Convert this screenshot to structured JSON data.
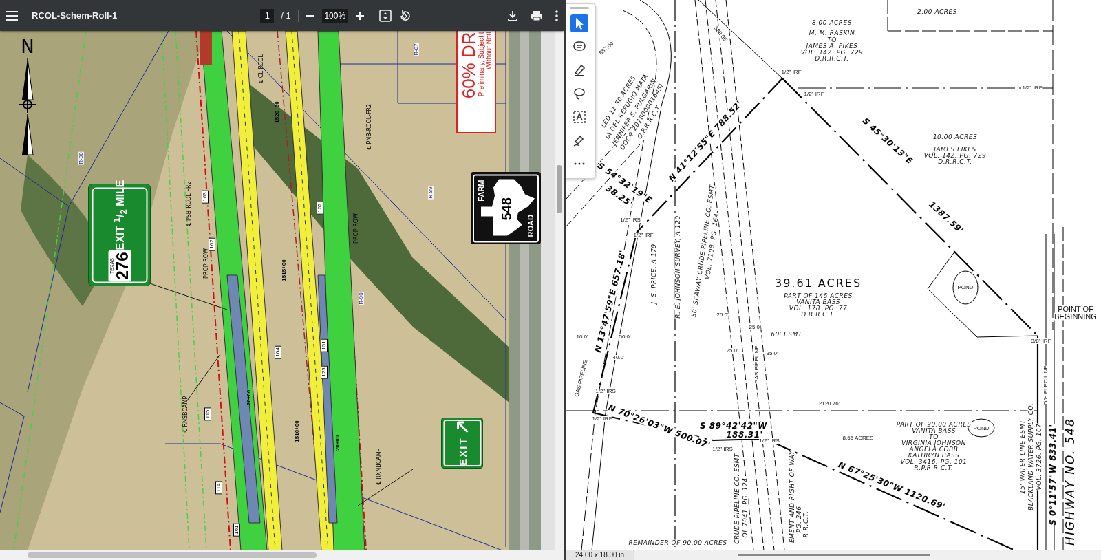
{
  "left_viewer": {
    "title": "RCOL-Schem-Roll-1",
    "page": "1",
    "page_total": "/ 1",
    "zoom": "100%",
    "map_labels": [
      {
        "text": "N",
        "kind": "north"
      },
      {
        "text": "R-88",
        "kind": "grid"
      },
      {
        "text": "R-87",
        "kind": "grid"
      },
      {
        "text": "R-89",
        "kind": "grid"
      },
      {
        "text": "R-90",
        "kind": "grid"
      },
      {
        "text": "1520+00",
        "kind": "station"
      },
      {
        "text": "1515+00",
        "kind": "station"
      },
      {
        "text": "1510+00",
        "kind": "station"
      },
      {
        "text": "163",
        "kind": "callout"
      },
      {
        "text": "162",
        "kind": "callout"
      },
      {
        "text": "152",
        "kind": "callout"
      },
      {
        "text": "151",
        "kind": "callout"
      },
      {
        "text": "123",
        "kind": "callout"
      },
      {
        "text": "104",
        "kind": "callout"
      },
      {
        "text": "115",
        "kind": "callout"
      },
      {
        "text": "114",
        "kind": "callout"
      },
      {
        "text": "161",
        "kind": "callout"
      },
      {
        "text": "℄ PSB-RCOL-FR2",
        "kind": "note"
      },
      {
        "text": "℄ PNB-RCOL-FR2",
        "kind": "note"
      },
      {
        "text": "℄ CL RCOL",
        "kind": "note"
      },
      {
        "text": "PROP ROW",
        "kind": "note"
      },
      {
        "text": "PROP ROW",
        "kind": "note"
      },
      {
        "text": "℄ RNSBCAMP",
        "kind": "note"
      },
      {
        "text": "℄ RXNBCAMP",
        "kind": "note"
      },
      {
        "text": "20+00",
        "kind": "station"
      },
      {
        "text": "20+00",
        "kind": "station"
      }
    ],
    "stamp": {
      "lines": [
        "60% DR",
        "Preliminary, Subject t",
        "Without Noti"
      ]
    },
    "signs": [
      {
        "kind": "guide",
        "shield_top": "TEXAS",
        "shield_number": "276",
        "legend": "EXIT $^{1}$/$_{2}$ MILE"
      },
      {
        "kind": "farm_road",
        "top": "FARM",
        "number": "548",
        "bottom": "ROAD"
      },
      {
        "kind": "exit",
        "legend": "EXIT"
      }
    ]
  },
  "right_viewer": {
    "tools": [
      {
        "kind": "select",
        "selected": true
      },
      {
        "kind": "comment",
        "selected": false
      },
      {
        "kind": "highlight",
        "selected": false
      },
      {
        "kind": "lasso",
        "selected": false
      },
      {
        "kind": "text",
        "selected": false
      },
      {
        "kind": "sign",
        "selected": false
      },
      {
        "kind": "more",
        "selected": false
      }
    ],
    "plat_labels": [
      {
        "text": "2.00 ACRES",
        "kind": "note"
      },
      {
        "text": "8.00 ACRES",
        "kind": "note"
      },
      {
        "text": "M. M. RASKIN",
        "kind": "note"
      },
      {
        "text": "TO",
        "kind": "note"
      },
      {
        "text": "JAMES A. FIKES",
        "kind": "note"
      },
      {
        "text": "VOL. 142. PG. 729",
        "kind": "note"
      },
      {
        "text": "D.R.R.C.T.",
        "kind": "note"
      },
      {
        "text": "1/2\" IRF",
        "kind": "marker"
      },
      {
        "text": "1/2\" IRF",
        "kind": "marker"
      },
      {
        "text": "1/2\" IRF",
        "kind": "marker"
      },
      {
        "text": "10.00 ACRES",
        "kind": "note"
      },
      {
        "text": "JAMES FIKES",
        "kind": "note"
      },
      {
        "text": "VOL. 142. PG. 729",
        "kind": "note"
      },
      {
        "text": "D.R.R.C.T.",
        "kind": "note"
      },
      {
        "text": "S 45°30'13\"E",
        "kind": "bearing"
      },
      {
        "text": "1387.59'",
        "kind": "bearing"
      },
      {
        "text": "N 41°12'55\"E 788.52'",
        "kind": "bearing"
      },
      {
        "text": "S 54°32'19\"E",
        "kind": "bearing"
      },
      {
        "text": "38.25'",
        "kind": "bearing"
      },
      {
        "text": "1/2\" IRS",
        "kind": "marker"
      },
      {
        "text": "1/2\" IRF",
        "kind": "marker"
      },
      {
        "text": "J. S. PRICE, A-179",
        "kind": "note"
      },
      {
        "text": "R. E. JOHNSON SURVEY, A-120",
        "kind": "note"
      },
      {
        "text": "50' SEAWAY CRUDE PIPELINE CO. ESMT",
        "kind": "note"
      },
      {
        "text": "VOL. 7108. PG. 164",
        "kind": "note"
      },
      {
        "text": "39.61 ACRES",
        "kind": "title"
      },
      {
        "text": "PART OF 146 ACRES",
        "kind": "note"
      },
      {
        "text": "VANITA BASS",
        "kind": "note"
      },
      {
        "text": "VOL. 178. PG. 77",
        "kind": "note"
      },
      {
        "text": "D.R.R.C.T.",
        "kind": "note"
      },
      {
        "text": "POND",
        "kind": "marker"
      },
      {
        "text": "POINT OF",
        "kind": "plain"
      },
      {
        "text": "BEGINNING",
        "kind": "plain"
      },
      {
        "text": "3/8\" IRF",
        "kind": "marker"
      },
      {
        "text": "N 13°47'59\"E 657.18'",
        "kind": "bearing"
      },
      {
        "text": "60' ESMT",
        "kind": "note"
      },
      {
        "text": "25.0'",
        "kind": "marker"
      },
      {
        "text": "25.0'",
        "kind": "marker"
      },
      {
        "text": "25.0'",
        "kind": "marker"
      },
      {
        "text": "35.0'",
        "kind": "marker"
      },
      {
        "text": "10.0'",
        "kind": "marker"
      },
      {
        "text": "50.0'",
        "kind": "marker"
      },
      {
        "text": "40.0'",
        "kind": "marker"
      },
      {
        "text": "GAS PIPELINE",
        "kind": "marker"
      },
      {
        "text": "GAS PIPELINE",
        "kind": "marker"
      },
      {
        "text": "O/H ELEC LINE",
        "kind": "marker"
      },
      {
        "text": "2120.76'",
        "kind": "marker"
      },
      {
        "text": "1/2\" IRS",
        "kind": "marker"
      },
      {
        "text": "1/2\" IRF",
        "kind": "marker"
      },
      {
        "text": "N 70°26'03\"W 500.07'",
        "kind": "bearing"
      },
      {
        "text": "S 89°42'42\"W",
        "kind": "bearing"
      },
      {
        "text": "188.31'",
        "kind": "bearing"
      },
      {
        "text": "1/2\" IRS",
        "kind": "marker"
      },
      {
        "text": "1/2\" IRS",
        "kind": "marker"
      },
      {
        "text": "8.65 ACRES",
        "kind": "marker"
      },
      {
        "text": "PART OF 90.00 ACRES",
        "kind": "note"
      },
      {
        "text": "VANITA BASS",
        "kind": "note"
      },
      {
        "text": "TO",
        "kind": "note"
      },
      {
        "text": "VIRGINIA JOHNSON",
        "kind": "note"
      },
      {
        "text": "ANGELA COBB",
        "kind": "note"
      },
      {
        "text": "KATHRYN BASS",
        "kind": "note"
      },
      {
        "text": "VOL. 3416. PG. 101",
        "kind": "note"
      },
      {
        "text": "R.P.R.R.C.T.",
        "kind": "note"
      },
      {
        "text": "POND",
        "kind": "marker"
      },
      {
        "text": "N 67°25'30\"W 1120.69'",
        "kind": "bearing"
      },
      {
        "text": "15' WATER LINE ESMT",
        "kind": "note"
      },
      {
        "text": "BLACKLAND WATER SUPPLY CO.",
        "kind": "note"
      },
      {
        "text": "VOL. 3726. PG. 107",
        "kind": "note"
      },
      {
        "text": "S 0°11'57\"W 833.41'",
        "kind": "bearing"
      },
      {
        "text": "HIGHWAY NO. 548",
        "kind": "road"
      },
      {
        "text": "CRUDE PIPELINE CO. ESMT",
        "kind": "note"
      },
      {
        "text": "OL 7041. PG. 124",
        "kind": "note"
      },
      {
        "text": "EMENT AND RIGHT OF WAY",
        "kind": "note"
      },
      {
        "text": "PG. 246",
        "kind": "note"
      },
      {
        "text": "R.R.C.T.",
        "kind": "note"
      },
      {
        "text": "REMAINDER OF 90.00 ACRES",
        "kind": "note"
      },
      {
        "text": "887.09'",
        "kind": "marker"
      },
      {
        "text": "588.06'",
        "kind": "marker"
      },
      {
        "text": "LED 11.50 ACRES",
        "kind": "note"
      },
      {
        "text": "IA DEL REFUGIO MATA",
        "kind": "note"
      },
      {
        "text": "JENNIFER S. PULGARIN",
        "kind": "note"
      },
      {
        "text": "DOC# 201600001645I",
        "kind": "note"
      },
      {
        "text": "O.P.R.R.C.T.",
        "kind": "note"
      }
    ],
    "status": "24.00 x 18.00 in"
  }
}
